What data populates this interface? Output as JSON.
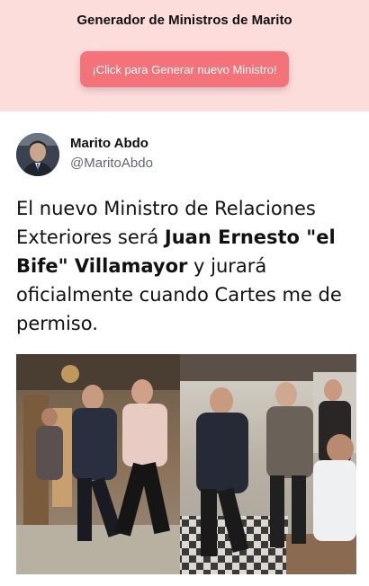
{
  "header": {
    "title": "Generador de Ministros de Marito",
    "button_label": "¡Click para Generar nuevo Ministro!",
    "background_color": "#fddcdc",
    "button_color": "#f4737a"
  },
  "tweet": {
    "author_name": "Marito Abdo",
    "author_handle": "@MaritoAbdo",
    "text_before": "El nuevo Ministro de Relaciones Exteriores será ",
    "text_highlight": "Juan Ernesto \"el Bife\" Villamayor",
    "text_after": " y jurará oficialmente cuando Cartes me de permiso."
  },
  "icons": {
    "avatar": "profile-photo",
    "media": "restaurant-scuffle-photo"
  }
}
